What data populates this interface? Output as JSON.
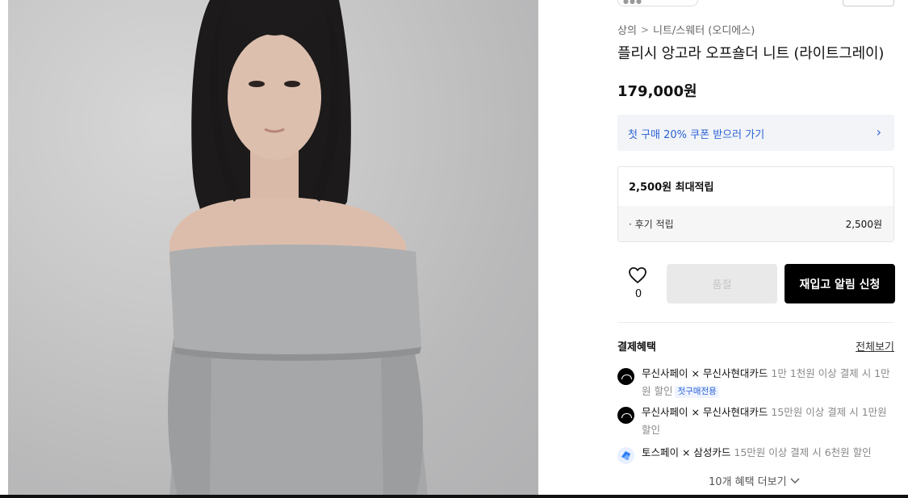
{
  "store": {
    "name": "?? ?? ??",
    "follow_label": "? ??"
  },
  "breadcrumb": {
    "root": "상의",
    "separator": ">",
    "category": "니트/스웨터 (오디에스)"
  },
  "product": {
    "title": "플리시 앙고라 오프숄더 니트 (라이트그레이)",
    "price": "179,000원"
  },
  "coupon": {
    "label": "첫 구매 20% 쿠폰 받으러 가기",
    "chevron": "›"
  },
  "points": {
    "header": "2,500원 최대적립",
    "row_label": "· 후기 적립",
    "row_value": "2,500원"
  },
  "actions": {
    "like_count": "0",
    "soldout_label": "품절",
    "restock_label": "재입고 알림 신청"
  },
  "benefits": {
    "title": "결제혜택",
    "view_all": "전체보기",
    "items": [
      {
        "icon": "musinsa-pay-icon",
        "name": "무신사페이 × 무신사현대카드",
        "desc": " 1만 1천원 이상 결제 시 1만원 할인",
        "tag": "첫구매전용"
      },
      {
        "icon": "musinsa-pay-icon",
        "name": "무신사페이 × 무신사현대카드",
        "desc": " 15만원 이상 결제 시 1만원 할인",
        "tag": ""
      },
      {
        "icon": "toss-pay-icon",
        "name": "토스페이 × 삼성카드",
        "desc": " 15만원 이상 결제 시 6천원 할인",
        "tag": ""
      }
    ],
    "more_label": "10개 혜택 더보기"
  },
  "colors": {
    "accent_blue": "#2b62d6",
    "coupon_bg": "#f2f4f8",
    "primary_button": "#000000",
    "disabled_button": "#e9e9e9"
  }
}
